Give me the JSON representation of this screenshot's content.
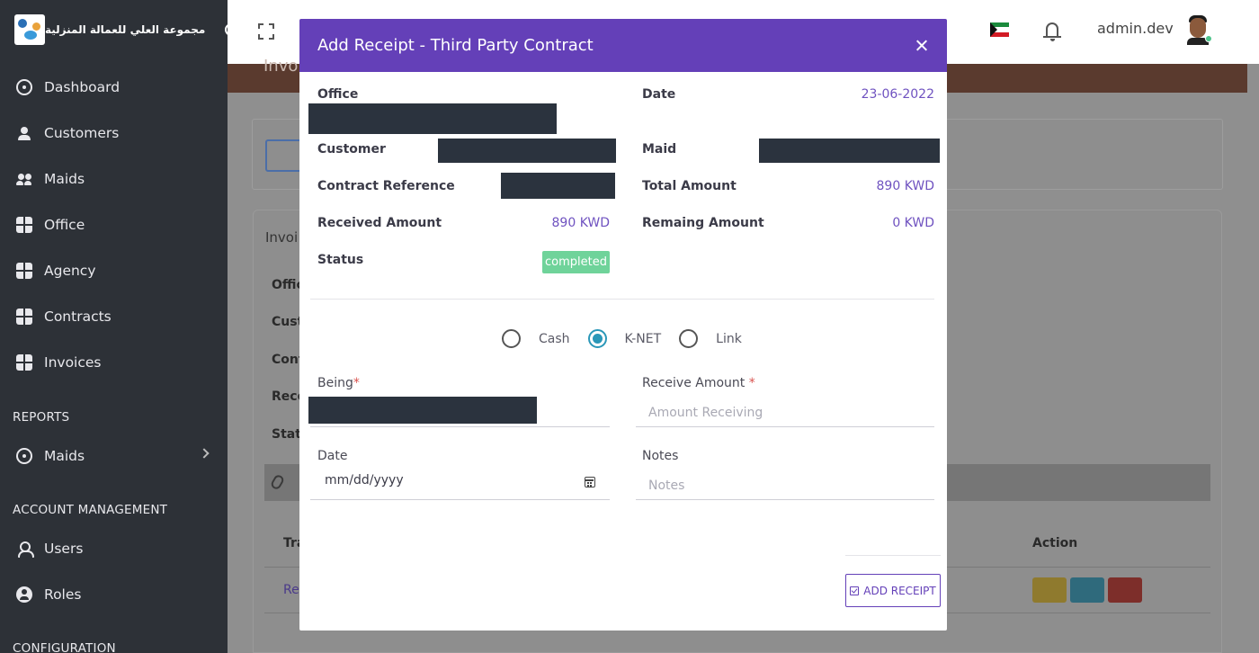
{
  "app": {
    "brand_name": "مجموعة العلي للعمالة المنزلية",
    "username": "admin.dev"
  },
  "sidebar": {
    "items": [
      {
        "label": "Dashboard",
        "icon": "dashboard-icon"
      },
      {
        "label": "Customers",
        "icon": "user-icon"
      },
      {
        "label": "Maids",
        "icon": "users-icon"
      },
      {
        "label": "Office",
        "icon": "box-icon"
      },
      {
        "label": "Agency",
        "icon": "box-icon"
      },
      {
        "label": "Contracts",
        "icon": "box-icon"
      },
      {
        "label": "Invoices",
        "icon": "box-icon"
      }
    ],
    "reports_label": "REPORTS",
    "reports_items": [
      {
        "label": "Maids",
        "icon": "dashboard-icon"
      }
    ],
    "account_label": "ACCOUNT MANAGEMENT",
    "account_items": [
      {
        "label": "Users",
        "icon": "user-outline-icon"
      },
      {
        "label": "Roles",
        "icon": "roles-icon"
      }
    ],
    "config_label": "CONFIGURATION"
  },
  "background": {
    "banner_text": "Invo",
    "card_title": "Invoi",
    "labels": [
      "Offic",
      "Cust",
      "Cont",
      "Rece",
      "Statu"
    ],
    "table_header_left": "Tra",
    "table_header_action": "Action",
    "row_link": "Rec"
  },
  "modal": {
    "title": "Add Receipt - Third Party Contract",
    "office_label": "Office",
    "date_label": "Date",
    "date_value": "23-06-2022",
    "customer_label": "Customer",
    "maid_label": "Maid",
    "contract_ref_label": "Contract Reference",
    "total_amount_label": "Total Amount",
    "total_amount_value": "890 KWD",
    "received_amount_label": "Received Amount",
    "received_amount_value": "890 KWD",
    "remaining_amount_label": "Remaing Amount",
    "remaining_amount_value": "0 KWD",
    "status_label": "Status",
    "status_value": "completed",
    "payment_methods": [
      {
        "label": "Cash",
        "checked": false
      },
      {
        "label": "K-NET",
        "checked": true
      },
      {
        "label": "Link",
        "checked": false
      }
    ],
    "being_label": "Being",
    "receive_amount_label": "Receive Amount ",
    "receive_amount_placeholder": "Amount Receiving",
    "date_field_label": "Date",
    "date_field_placeholder": "mm/dd/yyyy",
    "notes_label": "Notes",
    "notes_placeholder": "Notes",
    "required_mark": "*",
    "add_receipt_button": "ADD RECEIPT"
  },
  "colors": {
    "primary": "#6440b8",
    "sidebar_bg": "#2d3137",
    "status_completed": "#6fd39a",
    "radio_checked": "#2a97b8"
  }
}
